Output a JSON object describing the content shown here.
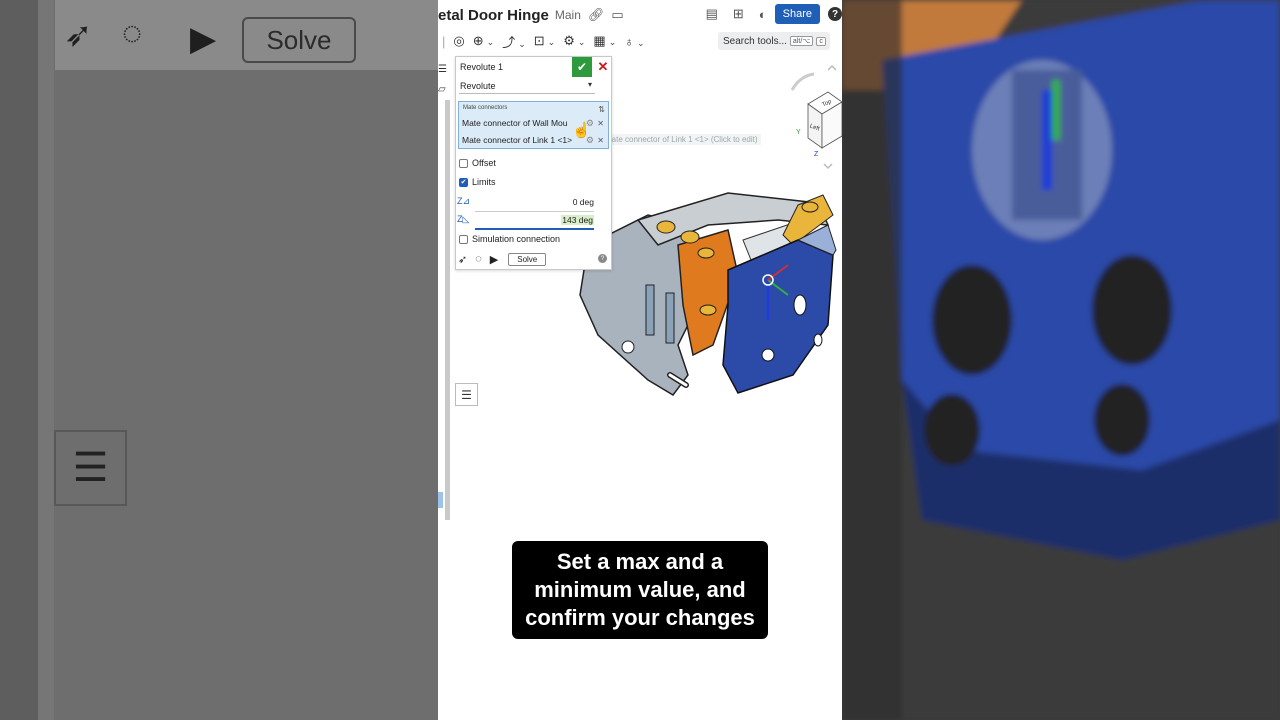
{
  "document": {
    "title": "etal Door Hinge",
    "branch": "Main",
    "share_label": "Share",
    "help_label": "?"
  },
  "toolbar": {
    "search_label": "Search tools...",
    "search_shortcut": "alt/⌥",
    "search_key": "c"
  },
  "dialog": {
    "title": "Revolute 1",
    "type_value": "Revolute",
    "mate_section_label": "Mate connectors",
    "mate_connectors": [
      "Mate connector of Wall Mou",
      "Mate connector of Link 1 <1>"
    ],
    "hover_tooltip": "Mate connector of Link 1 <1> (Click to edit)",
    "offset_label": "Offset",
    "offset_checked": false,
    "limits_label": "Limits",
    "limits_checked": true,
    "limit_min": "0 deg",
    "limit_max": "143 deg",
    "simulation_label": "Simulation connection",
    "simulation_checked": false,
    "solve_label": "Solve"
  },
  "backdrop": {
    "solve_label": "Solve"
  },
  "caption": {
    "text": "Set a max and a minimum value, and confirm your changes"
  },
  "colors": {
    "accent": "#1f5fb8",
    "ok_green": "#2e9a3e",
    "cancel_red": "#c81b1b",
    "part_blue": "#2c4aa8",
    "part_orange": "#e07a1f",
    "part_gray": "#a9b3bd",
    "part_gold": "#e9b53a"
  },
  "icons": [
    "search-icon",
    "link-icon",
    "folder-icon",
    "check-icon",
    "close-icon",
    "list-icon"
  ]
}
